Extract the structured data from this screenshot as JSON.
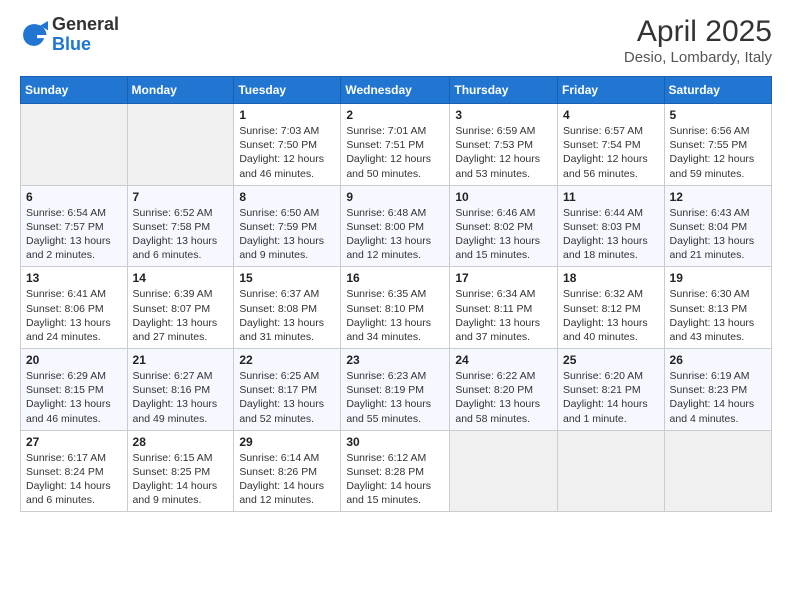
{
  "header": {
    "logo_general": "General",
    "logo_blue": "Blue",
    "title": "April 2025",
    "subtitle": "Desio, Lombardy, Italy"
  },
  "calendar": {
    "days_of_week": [
      "Sunday",
      "Monday",
      "Tuesday",
      "Wednesday",
      "Thursday",
      "Friday",
      "Saturday"
    ],
    "weeks": [
      [
        {
          "day": "",
          "sunrise": "",
          "sunset": "",
          "daylight": "",
          "empty": true
        },
        {
          "day": "",
          "sunrise": "",
          "sunset": "",
          "daylight": "",
          "empty": true
        },
        {
          "day": "1",
          "sunrise": "Sunrise: 7:03 AM",
          "sunset": "Sunset: 7:50 PM",
          "daylight": "Daylight: 12 hours and 46 minutes.",
          "empty": false
        },
        {
          "day": "2",
          "sunrise": "Sunrise: 7:01 AM",
          "sunset": "Sunset: 7:51 PM",
          "daylight": "Daylight: 12 hours and 50 minutes.",
          "empty": false
        },
        {
          "day": "3",
          "sunrise": "Sunrise: 6:59 AM",
          "sunset": "Sunset: 7:53 PM",
          "daylight": "Daylight: 12 hours and 53 minutes.",
          "empty": false
        },
        {
          "day": "4",
          "sunrise": "Sunrise: 6:57 AM",
          "sunset": "Sunset: 7:54 PM",
          "daylight": "Daylight: 12 hours and 56 minutes.",
          "empty": false
        },
        {
          "day": "5",
          "sunrise": "Sunrise: 6:56 AM",
          "sunset": "Sunset: 7:55 PM",
          "daylight": "Daylight: 12 hours and 59 minutes.",
          "empty": false
        }
      ],
      [
        {
          "day": "6",
          "sunrise": "Sunrise: 6:54 AM",
          "sunset": "Sunset: 7:57 PM",
          "daylight": "Daylight: 13 hours and 2 minutes.",
          "empty": false
        },
        {
          "day": "7",
          "sunrise": "Sunrise: 6:52 AM",
          "sunset": "Sunset: 7:58 PM",
          "daylight": "Daylight: 13 hours and 6 minutes.",
          "empty": false
        },
        {
          "day": "8",
          "sunrise": "Sunrise: 6:50 AM",
          "sunset": "Sunset: 7:59 PM",
          "daylight": "Daylight: 13 hours and 9 minutes.",
          "empty": false
        },
        {
          "day": "9",
          "sunrise": "Sunrise: 6:48 AM",
          "sunset": "Sunset: 8:00 PM",
          "daylight": "Daylight: 13 hours and 12 minutes.",
          "empty": false
        },
        {
          "day": "10",
          "sunrise": "Sunrise: 6:46 AM",
          "sunset": "Sunset: 8:02 PM",
          "daylight": "Daylight: 13 hours and 15 minutes.",
          "empty": false
        },
        {
          "day": "11",
          "sunrise": "Sunrise: 6:44 AM",
          "sunset": "Sunset: 8:03 PM",
          "daylight": "Daylight: 13 hours and 18 minutes.",
          "empty": false
        },
        {
          "day": "12",
          "sunrise": "Sunrise: 6:43 AM",
          "sunset": "Sunset: 8:04 PM",
          "daylight": "Daylight: 13 hours and 21 minutes.",
          "empty": false
        }
      ],
      [
        {
          "day": "13",
          "sunrise": "Sunrise: 6:41 AM",
          "sunset": "Sunset: 8:06 PM",
          "daylight": "Daylight: 13 hours and 24 minutes.",
          "empty": false
        },
        {
          "day": "14",
          "sunrise": "Sunrise: 6:39 AM",
          "sunset": "Sunset: 8:07 PM",
          "daylight": "Daylight: 13 hours and 27 minutes.",
          "empty": false
        },
        {
          "day": "15",
          "sunrise": "Sunrise: 6:37 AM",
          "sunset": "Sunset: 8:08 PM",
          "daylight": "Daylight: 13 hours and 31 minutes.",
          "empty": false
        },
        {
          "day": "16",
          "sunrise": "Sunrise: 6:35 AM",
          "sunset": "Sunset: 8:10 PM",
          "daylight": "Daylight: 13 hours and 34 minutes.",
          "empty": false
        },
        {
          "day": "17",
          "sunrise": "Sunrise: 6:34 AM",
          "sunset": "Sunset: 8:11 PM",
          "daylight": "Daylight: 13 hours and 37 minutes.",
          "empty": false
        },
        {
          "day": "18",
          "sunrise": "Sunrise: 6:32 AM",
          "sunset": "Sunset: 8:12 PM",
          "daylight": "Daylight: 13 hours and 40 minutes.",
          "empty": false
        },
        {
          "day": "19",
          "sunrise": "Sunrise: 6:30 AM",
          "sunset": "Sunset: 8:13 PM",
          "daylight": "Daylight: 13 hours and 43 minutes.",
          "empty": false
        }
      ],
      [
        {
          "day": "20",
          "sunrise": "Sunrise: 6:29 AM",
          "sunset": "Sunset: 8:15 PM",
          "daylight": "Daylight: 13 hours and 46 minutes.",
          "empty": false
        },
        {
          "day": "21",
          "sunrise": "Sunrise: 6:27 AM",
          "sunset": "Sunset: 8:16 PM",
          "daylight": "Daylight: 13 hours and 49 minutes.",
          "empty": false
        },
        {
          "day": "22",
          "sunrise": "Sunrise: 6:25 AM",
          "sunset": "Sunset: 8:17 PM",
          "daylight": "Daylight: 13 hours and 52 minutes.",
          "empty": false
        },
        {
          "day": "23",
          "sunrise": "Sunrise: 6:23 AM",
          "sunset": "Sunset: 8:19 PM",
          "daylight": "Daylight: 13 hours and 55 minutes.",
          "empty": false
        },
        {
          "day": "24",
          "sunrise": "Sunrise: 6:22 AM",
          "sunset": "Sunset: 8:20 PM",
          "daylight": "Daylight: 13 hours and 58 minutes.",
          "empty": false
        },
        {
          "day": "25",
          "sunrise": "Sunrise: 6:20 AM",
          "sunset": "Sunset: 8:21 PM",
          "daylight": "Daylight: 14 hours and 1 minute.",
          "empty": false
        },
        {
          "day": "26",
          "sunrise": "Sunrise: 6:19 AM",
          "sunset": "Sunset: 8:23 PM",
          "daylight": "Daylight: 14 hours and 4 minutes.",
          "empty": false
        }
      ],
      [
        {
          "day": "27",
          "sunrise": "Sunrise: 6:17 AM",
          "sunset": "Sunset: 8:24 PM",
          "daylight": "Daylight: 14 hours and 6 minutes.",
          "empty": false
        },
        {
          "day": "28",
          "sunrise": "Sunrise: 6:15 AM",
          "sunset": "Sunset: 8:25 PM",
          "daylight": "Daylight: 14 hours and 9 minutes.",
          "empty": false
        },
        {
          "day": "29",
          "sunrise": "Sunrise: 6:14 AM",
          "sunset": "Sunset: 8:26 PM",
          "daylight": "Daylight: 14 hours and 12 minutes.",
          "empty": false
        },
        {
          "day": "30",
          "sunrise": "Sunrise: 6:12 AM",
          "sunset": "Sunset: 8:28 PM",
          "daylight": "Daylight: 14 hours and 15 minutes.",
          "empty": false
        },
        {
          "day": "",
          "sunrise": "",
          "sunset": "",
          "daylight": "",
          "empty": true
        },
        {
          "day": "",
          "sunrise": "",
          "sunset": "",
          "daylight": "",
          "empty": true
        },
        {
          "day": "",
          "sunrise": "",
          "sunset": "",
          "daylight": "",
          "empty": true
        }
      ]
    ]
  }
}
